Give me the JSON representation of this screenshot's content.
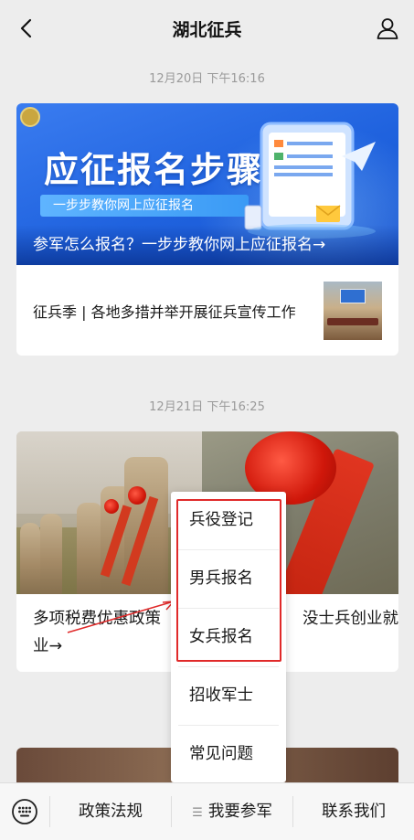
{
  "header": {
    "title": "湖北征兵"
  },
  "feed": [
    {
      "timestamp": "12月20日 下午16:16",
      "banner": {
        "headline": "应征报名步骤",
        "subtitle": "一步步教你网上应征报名",
        "caption": "参军怎么报名？一步步教你网上应征报名→"
      },
      "article": "征兵季 | 各地多措并举开展征兵宣传工作"
    },
    {
      "timestamp": "12月21日 下午16:25",
      "article_line1a": "多项税费优惠政策",
      "article_line1b": "没士兵创业就",
      "article_line2": "业→"
    }
  ],
  "menu": {
    "items": [
      "兵役登记",
      "男兵报名",
      "女兵报名",
      "招收军士",
      "常见问题"
    ]
  },
  "bottom_nav": {
    "tabs": [
      "政策法规",
      "我要参军",
      "联系我们"
    ]
  },
  "colors": {
    "banner_blue": "#1f62de",
    "highlight_red": "#e02a2a",
    "background": "#ededed"
  }
}
